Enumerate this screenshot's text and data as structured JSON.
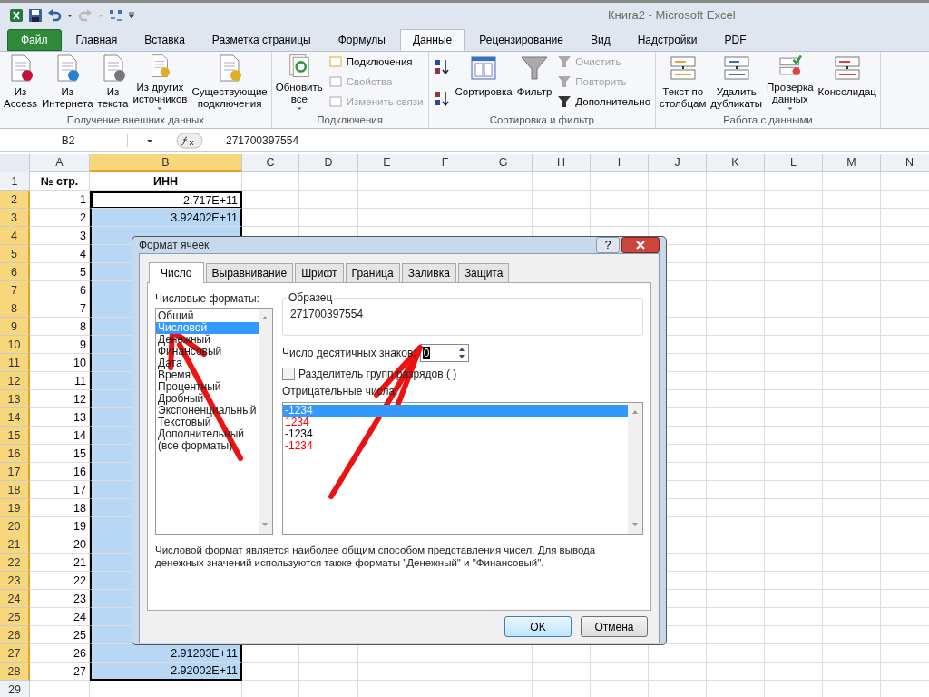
{
  "window": {
    "title": "Книга2  -  Microsoft Excel"
  },
  "ribbon_tabs": [
    {
      "label": "Файл",
      "kind": "file",
      "selected": false
    },
    {
      "label": "Главная",
      "kind": "tab",
      "selected": false
    },
    {
      "label": "Вставка",
      "kind": "tab",
      "selected": false
    },
    {
      "label": "Разметка страницы",
      "kind": "tab",
      "selected": false
    },
    {
      "label": "Формулы",
      "kind": "tab",
      "selected": false
    },
    {
      "label": "Данные",
      "kind": "tab",
      "selected": true
    },
    {
      "label": "Рецензирование",
      "kind": "tab",
      "selected": false
    },
    {
      "label": "Вид",
      "kind": "tab",
      "selected": false
    },
    {
      "label": "Надстройки",
      "kind": "tab",
      "selected": false
    },
    {
      "label": "PDF",
      "kind": "tab",
      "selected": false
    }
  ],
  "ribbon_groups": [
    {
      "label": "Получение внешних данных",
      "items": [
        {
          "kind": "large",
          "lines": [
            "Из",
            "Access"
          ],
          "dropdown": false,
          "disabled": false
        },
        {
          "kind": "large",
          "lines": [
            "Из",
            "Интернета"
          ],
          "dropdown": false,
          "disabled": false
        },
        {
          "kind": "large",
          "lines": [
            "Из",
            "текста"
          ],
          "dropdown": false,
          "disabled": false
        },
        {
          "kind": "large",
          "lines": [
            "Из других",
            "источников"
          ],
          "dropdown": true,
          "disabled": false
        },
        {
          "kind": "large",
          "lines": [
            "Существующие",
            "подключения"
          ],
          "dropdown": false,
          "disabled": false
        }
      ]
    },
    {
      "label": "Подключения",
      "items": [
        {
          "kind": "large",
          "lines": [
            "Обновить",
            "все"
          ],
          "dropdown": true,
          "disabled": false
        },
        {
          "kind": "small",
          "lines": [
            "Подключения"
          ],
          "dropdown": false,
          "disabled": false
        },
        {
          "kind": "small",
          "lines": [
            "Свойства"
          ],
          "dropdown": false,
          "disabled": true
        },
        {
          "kind": "small",
          "lines": [
            "Изменить связи"
          ],
          "dropdown": false,
          "disabled": true
        }
      ]
    },
    {
      "label": "Сортировка и фильтр",
      "items": [
        {
          "kind": "icon",
          "dropdown": false,
          "disabled": false
        },
        {
          "kind": "icon",
          "dropdown": false,
          "disabled": false
        },
        {
          "kind": "large",
          "lines": [
            "Сортировка"
          ],
          "dropdown": false,
          "disabled": false
        },
        {
          "kind": "large",
          "lines": [
            "Фильтр"
          ],
          "dropdown": false,
          "disabled": false
        },
        {
          "kind": "small",
          "lines": [
            "Очистить"
          ],
          "dropdown": false,
          "disabled": true
        },
        {
          "kind": "small",
          "lines": [
            "Повторить"
          ],
          "dropdown": false,
          "disabled": true
        },
        {
          "kind": "small",
          "lines": [
            "Дополнительно"
          ],
          "dropdown": false,
          "disabled": false
        }
      ]
    },
    {
      "label": "Работа с данными",
      "items": [
        {
          "kind": "large",
          "lines": [
            "Текст по",
            "столбцам"
          ],
          "dropdown": false,
          "disabled": false
        },
        {
          "kind": "large",
          "lines": [
            "Удалить",
            "дубликаты"
          ],
          "dropdown": false,
          "disabled": false
        },
        {
          "kind": "large",
          "lines": [
            "Проверка",
            "данных"
          ],
          "dropdown": true,
          "disabled": false
        },
        {
          "kind": "large",
          "lines": [
            "Консолидац"
          ],
          "dropdown": false,
          "disabled": false
        }
      ]
    }
  ],
  "formula_bar": {
    "name_box": "B2",
    "formula": "271700397554"
  },
  "sheet": {
    "columns": [
      {
        "label": "A",
        "selected": false
      },
      {
        "label": "B",
        "selected": true
      },
      {
        "label": "C",
        "selected": false
      },
      {
        "label": "D",
        "selected": false
      },
      {
        "label": "E",
        "selected": false
      },
      {
        "label": "F",
        "selected": false
      },
      {
        "label": "G",
        "selected": false
      },
      {
        "label": "H",
        "selected": false
      },
      {
        "label": "I",
        "selected": false
      },
      {
        "label": "J",
        "selected": false
      },
      {
        "label": "K",
        "selected": false
      },
      {
        "label": "L",
        "selected": false
      },
      {
        "label": "M",
        "selected": false
      },
      {
        "label": "N",
        "selected": false
      }
    ],
    "rows": [
      {
        "n": "1",
        "a": "№ стр.",
        "b": "ИНН",
        "selected": false,
        "active": false,
        "kind": "header"
      },
      {
        "n": "2",
        "a": "1",
        "b": "2.717E+11",
        "selected": true,
        "active": true,
        "kind": "data"
      },
      {
        "n": "3",
        "a": "2",
        "b": "3.92402E+11",
        "selected": true,
        "active": false,
        "kind": "data"
      },
      {
        "n": "4",
        "a": "3",
        "selected": true,
        "active": false,
        "kind": "data"
      },
      {
        "n": "5",
        "a": "4",
        "selected": true,
        "active": false,
        "kind": "data"
      },
      {
        "n": "6",
        "a": "5",
        "selected": true,
        "active": false,
        "kind": "data"
      },
      {
        "n": "7",
        "a": "6",
        "selected": true,
        "active": false,
        "kind": "data"
      },
      {
        "n": "8",
        "a": "7",
        "selected": true,
        "active": false,
        "kind": "data"
      },
      {
        "n": "9",
        "a": "8",
        "selected": true,
        "active": false,
        "kind": "data"
      },
      {
        "n": "10",
        "a": "9",
        "selected": true,
        "active": false,
        "kind": "data"
      },
      {
        "n": "11",
        "a": "10",
        "selected": true,
        "active": false,
        "kind": "data"
      },
      {
        "n": "12",
        "a": "11",
        "selected": true,
        "active": false,
        "kind": "data"
      },
      {
        "n": "13",
        "a": "12",
        "selected": true,
        "active": false,
        "kind": "data"
      },
      {
        "n": "14",
        "a": "13",
        "selected": true,
        "active": false,
        "kind": "data"
      },
      {
        "n": "15",
        "a": "14",
        "selected": true,
        "active": false,
        "kind": "data"
      },
      {
        "n": "16",
        "a": "15",
        "selected": true,
        "active": false,
        "kind": "data"
      },
      {
        "n": "17",
        "a": "16",
        "selected": true,
        "active": false,
        "kind": "data"
      },
      {
        "n": "18",
        "a": "17",
        "selected": true,
        "active": false,
        "kind": "data"
      },
      {
        "n": "19",
        "a": "18",
        "selected": true,
        "active": false,
        "kind": "data"
      },
      {
        "n": "20",
        "a": "19",
        "selected": true,
        "active": false,
        "kind": "data"
      },
      {
        "n": "21",
        "a": "20",
        "selected": true,
        "active": false,
        "kind": "data"
      },
      {
        "n": "22",
        "a": "21",
        "selected": true,
        "active": false,
        "kind": "data"
      },
      {
        "n": "23",
        "a": "22",
        "selected": true,
        "active": false,
        "kind": "data"
      },
      {
        "n": "24",
        "a": "23",
        "selected": true,
        "active": false,
        "kind": "data"
      },
      {
        "n": "25",
        "a": "24",
        "selected": true,
        "active": false,
        "kind": "data"
      },
      {
        "n": "26",
        "a": "25",
        "selected": true,
        "active": false,
        "kind": "data"
      },
      {
        "n": "27",
        "a": "26",
        "b": "2.91203E+11",
        "selected": true,
        "active": false,
        "kind": "data"
      },
      {
        "n": "28",
        "a": "27",
        "b": "2.92002E+11",
        "selected": true,
        "active": false,
        "kind": "data"
      },
      {
        "n": "29",
        "selected": false,
        "active": false,
        "kind": "data"
      }
    ]
  },
  "dialog": {
    "title": "Формат ячеек",
    "help": "?",
    "tabs": [
      {
        "label": "Число",
        "selected": true
      },
      {
        "label": "Выравнивание",
        "selected": false
      },
      {
        "label": "Шрифт",
        "selected": false
      },
      {
        "label": "Граница",
        "selected": false
      },
      {
        "label": "Заливка",
        "selected": false
      },
      {
        "label": "Защита",
        "selected": false
      }
    ],
    "formats_label": "Числовые форматы:",
    "formats": [
      {
        "label": "Общий",
        "selected": false
      },
      {
        "label": "Числовой",
        "selected": true
      },
      {
        "label": "Денежный",
        "selected": false
      },
      {
        "label": "Финансовый",
        "selected": false
      },
      {
        "label": "Дата",
        "selected": false
      },
      {
        "label": "Время",
        "selected": false
      },
      {
        "label": "Процентный",
        "selected": false
      },
      {
        "label": "Дробный",
        "selected": false
      },
      {
        "label": "Экспоненциальный",
        "selected": false
      },
      {
        "label": "Текстовый",
        "selected": false
      },
      {
        "label": "Дополнительный",
        "selected": false
      },
      {
        "label": "(все форматы)",
        "selected": false
      }
    ],
    "sample": {
      "label": "Образец",
      "value": "271700397554"
    },
    "decimals": {
      "label": "Число десятичных знаков:",
      "value": "0"
    },
    "separator": {
      "label": "Разделитель групп разрядов ( )",
      "checked": false
    },
    "negatives_label": "Отрицательные числа:",
    "negatives": [
      {
        "label": "-1234",
        "selected": true
      },
      {
        "label": "1234",
        "color": "#ff0000",
        "selected": false
      },
      {
        "label": "-1234",
        "color": "#000000",
        "selected": false
      },
      {
        "label": "-1234",
        "color": "#ff0000",
        "selected": false
      }
    ],
    "description": "Числовой формат является наиболее общим способом представления чисел. Для вывода денежных значений используются также форматы \"Денежный\" и \"Финансовый\".",
    "buttons": [
      "OK",
      "Отмена"
    ]
  }
}
